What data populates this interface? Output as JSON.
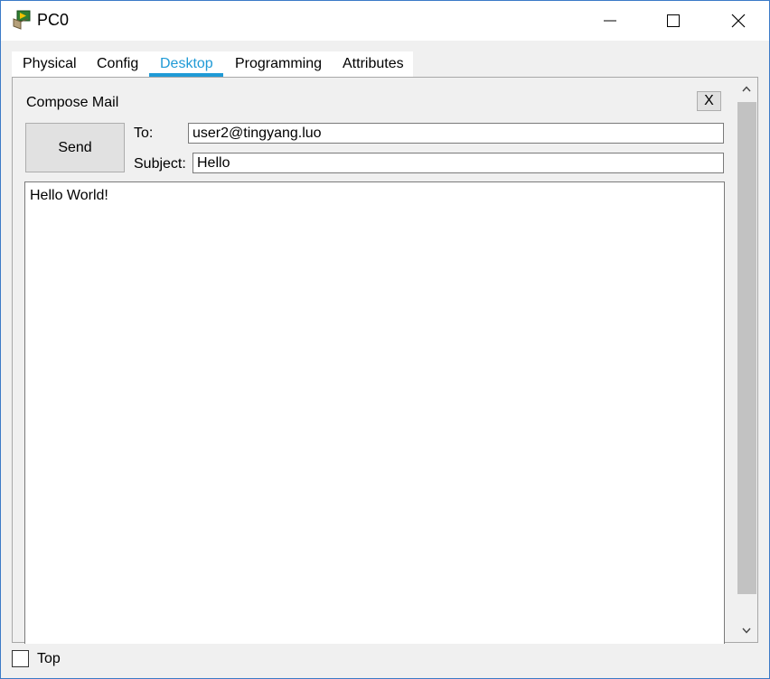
{
  "window": {
    "title": "PC0",
    "icon": "packet-tracer-pc-icon"
  },
  "tabs": [
    {
      "label": "Physical",
      "active": false
    },
    {
      "label": "Config",
      "active": false
    },
    {
      "label": "Desktop",
      "active": true
    },
    {
      "label": "Programming",
      "active": false
    },
    {
      "label": "Attributes",
      "active": false
    }
  ],
  "compose": {
    "title": "Compose Mail",
    "close_label": "X",
    "send_label": "Send",
    "to_label": "To:",
    "to_value": "user2@tingyang.luo",
    "subject_label": "Subject:",
    "subject_value": "Hello",
    "body_value": "Hello World!"
  },
  "footer": {
    "top_label": "Top",
    "top_checked": false
  },
  "colors": {
    "accent": "#1f9ad6",
    "window_border": "#3b7ac7"
  }
}
